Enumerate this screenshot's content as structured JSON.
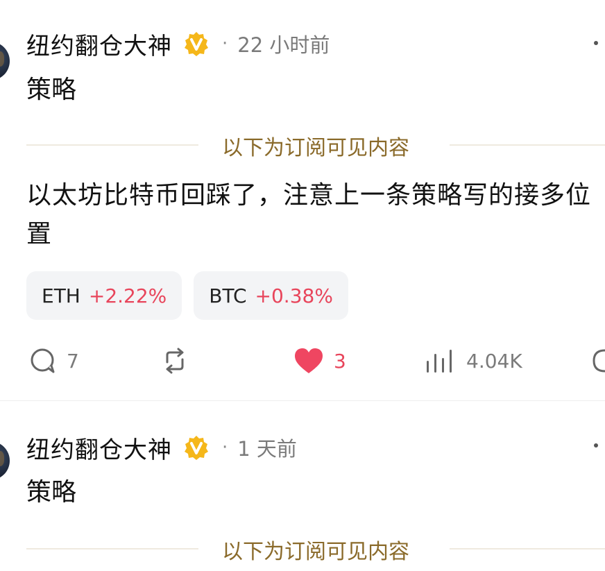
{
  "posts": [
    {
      "author": "纽约翻仓大神",
      "time": "22 小时前",
      "tag": "策略",
      "subscriber_label": "以下为订阅可见内容",
      "body": "以太坊比特币回踩了，注意上一条策略写的接多位置",
      "tickers": [
        {
          "symbol": "ETH",
          "change": "+2.22%"
        },
        {
          "symbol": "BTC",
          "change": "+0.38%"
        }
      ],
      "actions": {
        "comments": "7",
        "reposts": "",
        "likes": "3",
        "views": "4.04K"
      }
    },
    {
      "author": "纽约翻仓大神",
      "time": "1 天前",
      "tag": "策略",
      "subscriber_label": "以下为订阅可见内容"
    }
  ],
  "sep": "·",
  "colors": {
    "accent_gold": "#8a6a2a",
    "verified_badge": "#f5b71a",
    "positive_change": "#e8455b",
    "like_heart": "#ef4661"
  }
}
